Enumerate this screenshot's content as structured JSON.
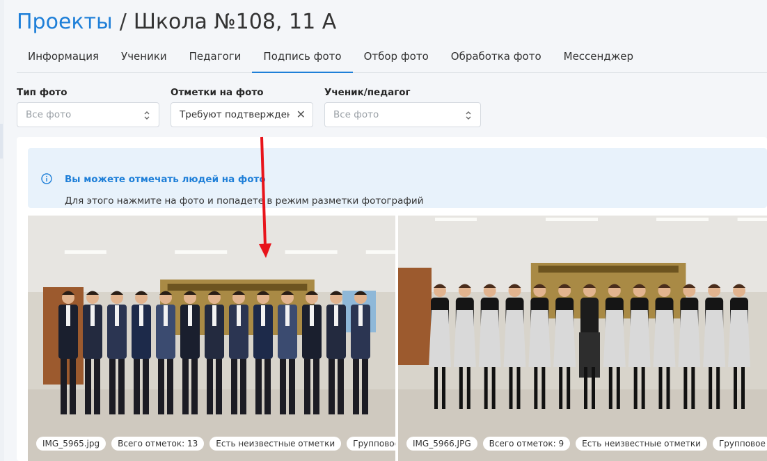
{
  "breadcrumb": {
    "link": "Проекты",
    "separator": "/",
    "current": "Школа №108, 11 А"
  },
  "tabs": [
    {
      "label": "Информация"
    },
    {
      "label": "Ученики"
    },
    {
      "label": "Педагоги"
    },
    {
      "label": "Подпись фото",
      "active": true
    },
    {
      "label": "Отбор фото"
    },
    {
      "label": "Обработка фото"
    },
    {
      "label": "Мессенджер"
    }
  ],
  "filters": {
    "photo_type": {
      "label": "Тип фото",
      "placeholder": "Все фото"
    },
    "marks": {
      "label": "Отметки на фото",
      "value": "Требуют подтверждения"
    },
    "person": {
      "label": "Ученик/педагог",
      "placeholder": "Все фото"
    }
  },
  "info": {
    "icon": "info-circle-icon",
    "title": "Вы можете отмечать людей на фото",
    "text": "Для этого нажмите на фото и попадете в режим разметки фотографий"
  },
  "photos": [
    {
      "filename": "IMG_5965.jpg",
      "total_marks": "Всего отметок: 13",
      "unknown": "Есть неизвестные отметки",
      "type": "Групповое",
      "people_count": 13
    },
    {
      "filename": "IMG_5966.JPG",
      "total_marks": "Всего отметок: 9",
      "unknown": "Есть неизвестные отметки",
      "type": "Групповое",
      "people_count": 13
    }
  ],
  "colors": {
    "accent": "#1e7fd8",
    "info_bg": "#e8f2fb",
    "annotation_arrow": "#e8141b"
  }
}
